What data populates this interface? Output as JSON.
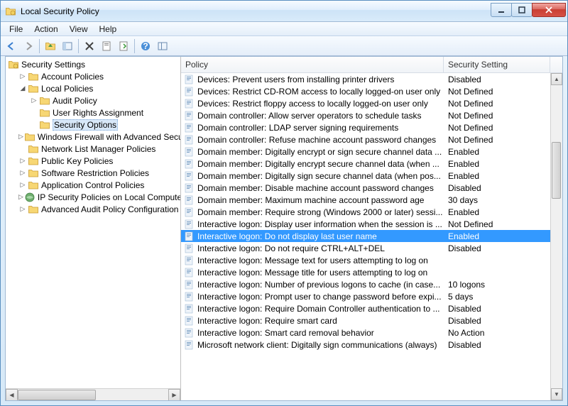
{
  "window": {
    "title": "Local Security Policy"
  },
  "menu": {
    "file": "File",
    "action": "Action",
    "view": "View",
    "help": "Help"
  },
  "tree": {
    "root": "Security Settings",
    "items": [
      {
        "label": "Account Policies",
        "indent": 1,
        "expander": "▷",
        "icon": "folder"
      },
      {
        "label": "Local Policies",
        "indent": 1,
        "expander": "◢",
        "icon": "folder"
      },
      {
        "label": "Audit Policy",
        "indent": 2,
        "expander": "▷",
        "icon": "folder"
      },
      {
        "label": "User Rights Assignment",
        "indent": 2,
        "expander": "",
        "icon": "folder"
      },
      {
        "label": "Security Options",
        "indent": 2,
        "expander": "",
        "icon": "folder",
        "selected": true
      },
      {
        "label": "Windows Firewall with Advanced Secu",
        "indent": 1,
        "expander": "▷",
        "icon": "folder"
      },
      {
        "label": "Network List Manager Policies",
        "indent": 1,
        "expander": "",
        "icon": "folder"
      },
      {
        "label": "Public Key Policies",
        "indent": 1,
        "expander": "▷",
        "icon": "folder"
      },
      {
        "label": "Software Restriction Policies",
        "indent": 1,
        "expander": "▷",
        "icon": "folder"
      },
      {
        "label": "Application Control Policies",
        "indent": 1,
        "expander": "▷",
        "icon": "folder"
      },
      {
        "label": "IP Security Policies on Local Compute",
        "indent": 1,
        "expander": "▷",
        "icon": "ipsec"
      },
      {
        "label": "Advanced Audit Policy Configuration",
        "indent": 1,
        "expander": "▷",
        "icon": "folder"
      }
    ]
  },
  "columns": {
    "policy": "Policy",
    "setting": "Security Setting"
  },
  "policies": [
    {
      "name": "Devices: Prevent users from installing printer drivers",
      "setting": "Disabled"
    },
    {
      "name": "Devices: Restrict CD-ROM access to locally logged-on user only",
      "setting": "Not Defined"
    },
    {
      "name": "Devices: Restrict floppy access to locally logged-on user only",
      "setting": "Not Defined"
    },
    {
      "name": "Domain controller: Allow server operators to schedule tasks",
      "setting": "Not Defined"
    },
    {
      "name": "Domain controller: LDAP server signing requirements",
      "setting": "Not Defined"
    },
    {
      "name": "Domain controller: Refuse machine account password changes",
      "setting": "Not Defined"
    },
    {
      "name": "Domain member: Digitally encrypt or sign secure channel data ...",
      "setting": "Enabled"
    },
    {
      "name": "Domain member: Digitally encrypt secure channel data (when ...",
      "setting": "Enabled"
    },
    {
      "name": "Domain member: Digitally sign secure channel data (when pos...",
      "setting": "Enabled"
    },
    {
      "name": "Domain member: Disable machine account password changes",
      "setting": "Disabled"
    },
    {
      "name": "Domain member: Maximum machine account password age",
      "setting": "30 days"
    },
    {
      "name": "Domain member: Require strong (Windows 2000 or later) sessi...",
      "setting": "Enabled"
    },
    {
      "name": "Interactive logon: Display user information when the session is ...",
      "setting": "Not Defined"
    },
    {
      "name": "Interactive logon: Do not display last user name",
      "setting": "Enabled",
      "selected": true
    },
    {
      "name": "Interactive logon: Do not require CTRL+ALT+DEL",
      "setting": "Disabled"
    },
    {
      "name": "Interactive logon: Message text for users attempting to log on",
      "setting": ""
    },
    {
      "name": "Interactive logon: Message title for users attempting to log on",
      "setting": ""
    },
    {
      "name": "Interactive logon: Number of previous logons to cache (in case...",
      "setting": "10 logons"
    },
    {
      "name": "Interactive logon: Prompt user to change password before expi...",
      "setting": "5 days"
    },
    {
      "name": "Interactive logon: Require Domain Controller authentication to ...",
      "setting": "Disabled"
    },
    {
      "name": "Interactive logon: Require smart card",
      "setting": "Disabled"
    },
    {
      "name": "Interactive logon: Smart card removal behavior",
      "setting": "No Action"
    },
    {
      "name": "Microsoft network client: Digitally sign communications (always)",
      "setting": "Disabled"
    }
  ]
}
